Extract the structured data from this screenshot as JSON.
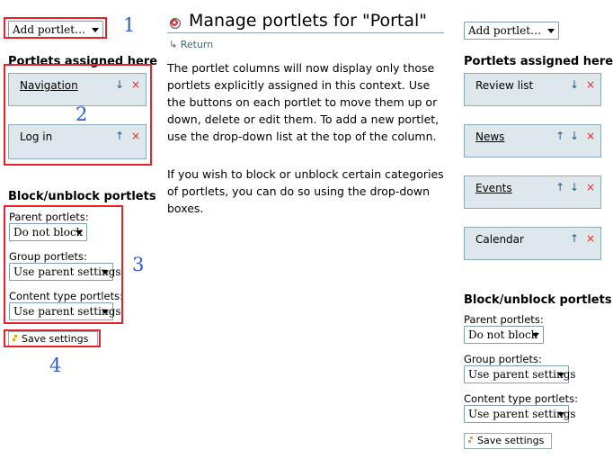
{
  "page": {
    "title": "Manage portlets for \"Portal\"",
    "return_label": "Return",
    "paragraph_1": "The portlet columns will now display only those portlets explicitly assigned in this context. Use the buttons on each portlet to move them up or down, delete or edit them. To add a new portlet, use the drop-down list at the top of the column.",
    "paragraph_2": "If you wish to block or unblock certain categories of portlets, you can do so using the drop-down boxes."
  },
  "left": {
    "add_portlet": "Add portlet…",
    "assigned_heading": "Portlets assigned here",
    "portlets": [
      {
        "name": "Navigation",
        "link": true,
        "up": false,
        "down": true
      },
      {
        "name": "Log in",
        "link": false,
        "up": true,
        "down": false
      }
    ],
    "block_heading": "Block/unblock portlets",
    "parent_label": "Parent portlets:",
    "parent_value": "Do not block",
    "group_label": "Group portlets:",
    "group_value": "Use parent settings",
    "content_label": "Content type portlets:",
    "content_value": "Use parent settings",
    "save_label": "Save settings"
  },
  "right": {
    "add_portlet": "Add portlet…",
    "assigned_heading": "Portlets assigned here",
    "portlets": [
      {
        "name": "Review list",
        "link": false,
        "up": false,
        "down": true
      },
      {
        "name": "News",
        "link": true,
        "up": true,
        "down": true
      },
      {
        "name": "Events",
        "link": true,
        "up": true,
        "down": true
      },
      {
        "name": "Calendar",
        "link": false,
        "up": true,
        "down": false
      }
    ],
    "block_heading": "Block/unblock portlets",
    "parent_label": "Parent portlets:",
    "parent_value": "Do not block",
    "group_label": "Group portlets:",
    "group_value": "Use parent settings",
    "content_label": "Content type portlets:",
    "content_value": "Use parent settings",
    "save_label": "Save settings"
  },
  "annotations": {
    "n1": "1",
    "n2": "2",
    "n3": "3",
    "n4": "4"
  },
  "icons": {
    "up": "↑",
    "down": "↓",
    "delete": "×"
  },
  "colors": {
    "annotation_frame": "#e8202a",
    "annotation_number": "#2a5bd7",
    "portlet_bg": "#dee7ec",
    "portlet_border": "#8cacbb",
    "arrow": "#205c90",
    "delete": "#ee2222"
  }
}
